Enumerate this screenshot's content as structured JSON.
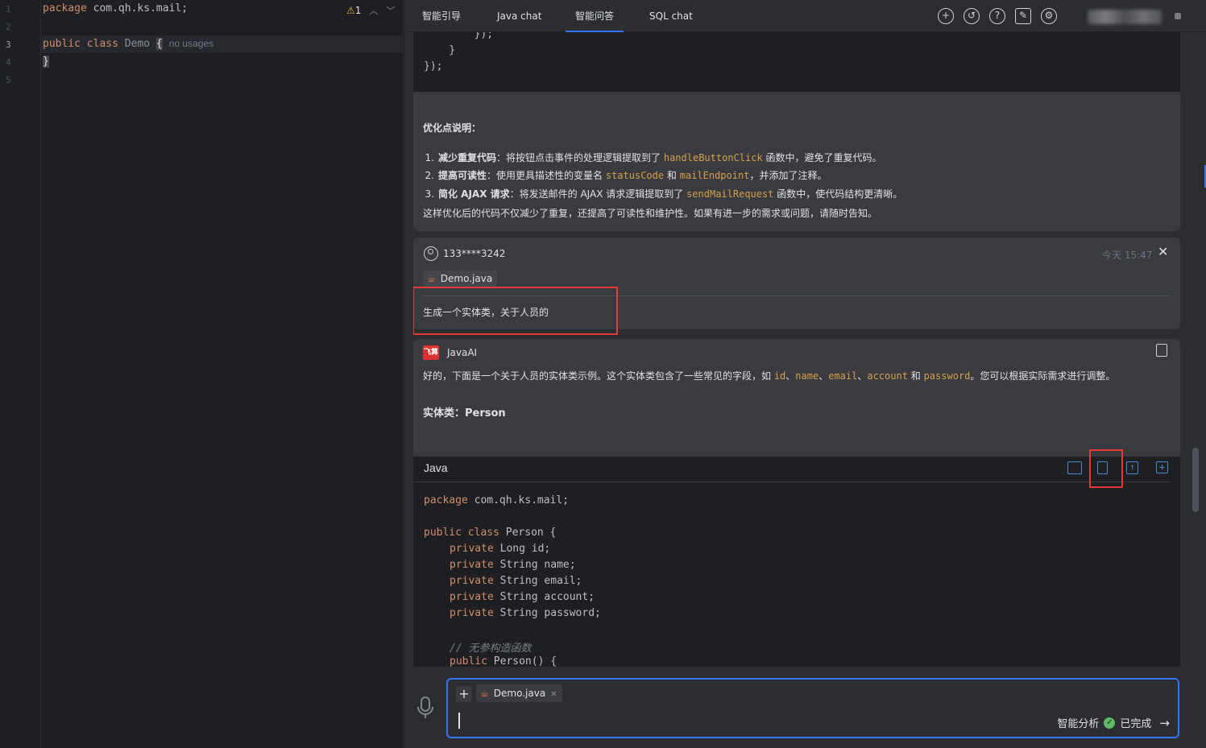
{
  "editor": {
    "line_numbers": [
      "1",
      "2",
      "3",
      "4",
      "5"
    ],
    "line1": {
      "keyword": "package",
      "rest": " com.qh.ks.mail;"
    },
    "line3": {
      "kw1": "public",
      "kw2": "class",
      "name": "Demo",
      "brace": "{",
      "hint": "no usages"
    },
    "line4": {
      "brace": "}"
    },
    "warnings": {
      "count": "1"
    }
  },
  "tabs": [
    {
      "label": "智能引导"
    },
    {
      "label": "Java chat"
    },
    {
      "label": "智能问答"
    },
    {
      "label": "SQL chat"
    }
  ],
  "toolbar_icons": [
    "add-icon",
    "history-icon",
    "help-icon",
    "edit-icon",
    "settings-icon"
  ],
  "prev_answer": {
    "code_tail": [
      "        });",
      "    }",
      "});"
    ],
    "title": "优化点说明：",
    "items": [
      {
        "num": "1.",
        "bold": "减少重复代码",
        "pre": "：将按钮点击事件的处理逻辑提取到了 ",
        "code1": "handleButtonClick",
        "post": " 函数中，避免了重复代码。"
      },
      {
        "num": "2.",
        "bold": "提高可读性",
        "pre": "：使用更具描述性的变量名 ",
        "code1": "statusCode",
        "mid": " 和 ",
        "code2": "mailEndpoint",
        "post": "，并添加了注释。"
      },
      {
        "num": "3.",
        "bold": "简化 AJAX 请求",
        "pre": "：将发送邮件的 AJAX 请求逻辑提取到了 ",
        "code1": "sendMailRequest",
        "post": " 函数中，使代码结构更清晰。"
      }
    ],
    "summary": "这样优化后的代码不仅减少了重复，还提高了可读性和维护性。如果有进一步的需求或问题，请随时告知。"
  },
  "user_msg": {
    "user": "133****3242",
    "time": "今天 15:47",
    "file": "Demo.java",
    "text": "生成一个实体类，关于人员的"
  },
  "ai_msg": {
    "logo": "飞算",
    "name": "JavaAI",
    "intro_pre": "好的，下面是一个关于人员的实体类示例。这个实体类包含了一些常见的字段，如 ",
    "fields": [
      "id",
      "name",
      "email",
      "account",
      "password"
    ],
    "sep": "、",
    "and": " 和 ",
    "intro_post": "。您可以根据实际需求进行调整。",
    "entity_heading": "实体类：Person",
    "code_lang": "Java",
    "code": {
      "l1_kw": "package",
      "l1_rest": " com.qh.ks.mail;",
      "l3_kw1": "public",
      "l3_kw2": "class",
      "l3_rest": " Person {",
      "fields": [
        {
          "kw": "private",
          "rest": " Long id;"
        },
        {
          "kw": "private",
          "rest": " String name;"
        },
        {
          "kw": "private",
          "rest": " String email;"
        },
        {
          "kw": "private",
          "rest": " String account;"
        },
        {
          "kw": "private",
          "rest": " String password;"
        }
      ],
      "comment": "// 无参构造函数",
      "ctor_kw": "public",
      "ctor_rest": " Person() {"
    }
  },
  "input": {
    "attached_file": "Demo.java",
    "mode_label": "智能分析",
    "status_label": "已完成"
  },
  "colors": {
    "accent": "#3574f0",
    "highlight_red": "#e53935",
    "keyword": "#cf8e6d",
    "inline_code": "#d5a04a",
    "success": "#5fb865"
  }
}
